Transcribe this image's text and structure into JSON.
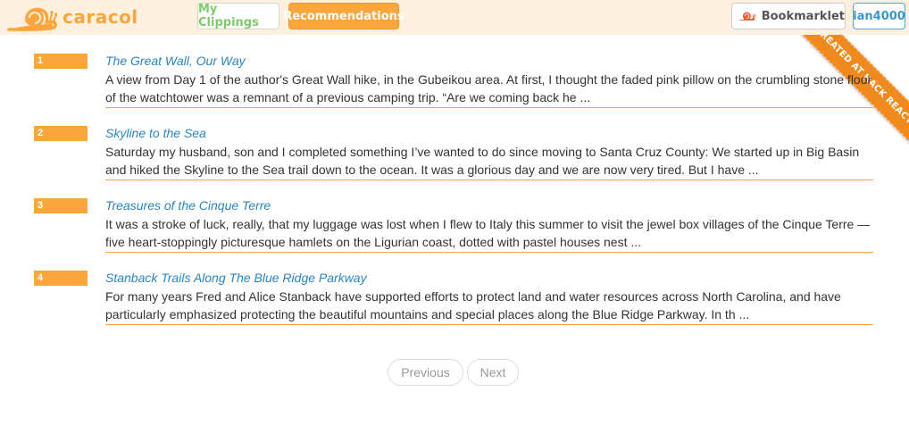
{
  "app": {
    "name": "caracol",
    "brand_color": "#fba63c"
  },
  "nav": {
    "clippings_label": "My Clippings",
    "recommendations_label": "Recommendations",
    "bookmarklet_label": "Bookmarklet",
    "user_label": "ian4000"
  },
  "ribbon": {
    "text": "CREATED AT HACK REACTOR"
  },
  "items": [
    {
      "number": "1",
      "title": "The Great Wall, Our Way",
      "description": "A view from Day 1 of the author's Great Wall hike, in the Gubeikou area. At first, I thought the faded pink pillow on the crumbling stone floor of the watchtower was a remnant of a previous camping trip. “Are we coming back he ..."
    },
    {
      "number": "2",
      "title": "Skyline to the Sea",
      "description": "Saturday my husband, son and I completed something I’ve wanted to do since moving to Santa Cruz County: We started up in Big Basin and hiked the Skyline to the Sea trail down to the ocean. It was a glorious day and we are now very tired. But I have ..."
    },
    {
      "number": "3",
      "title": "Treasures of the Cinque Terre",
      "description": "It was a stroke of luck, really, that my luggage was lost when I flew to Italy this summer to visit the jewel box villages of the Cinque Terre — five heart-stoppingly picturesque hamlets on the Ligurian coast, dotted with pastel houses nest ..."
    },
    {
      "number": "4",
      "title": "Stanback Trails Along The Blue Ridge Parkway",
      "description": "For many years Fred and Alice Stanback have supported efforts to protect land and water resources across North Carolina, and have particularly emphasized protecting the beautiful mountains and special places along the Blue Ridge Parkway. In th ..."
    }
  ],
  "pagination": {
    "previous_label": "Previous",
    "next_label": "Next"
  }
}
